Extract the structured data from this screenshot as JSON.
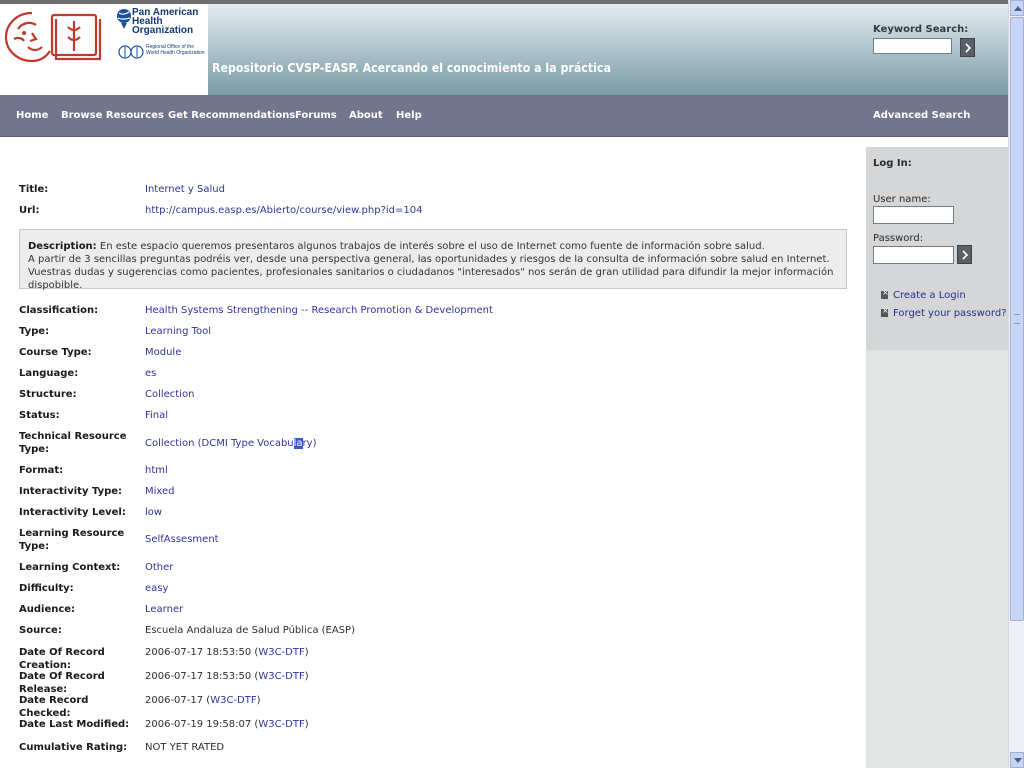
{
  "header": {
    "org_name": "Pan American Health Organization",
    "who_caption": "Regional Office of the World Health Organization",
    "site_title": "Repositorio CVSP-EASP. Acercando el conocimiento a la práctica",
    "keyword_label": "Keyword Search:",
    "keyword_value": ""
  },
  "nav": {
    "items": [
      "Home",
      "Browse Resources",
      "Get Recommendations",
      "Forums",
      "About",
      "Help"
    ],
    "advanced": "Advanced Search"
  },
  "login": {
    "heading": "Log In:",
    "username_label": "User name:",
    "password_label": "Password:",
    "create_login": "Create a Login",
    "forgot": "Forget your password?"
  },
  "record": {
    "title": {
      "label": "Title:",
      "value": "Internet y Salud"
    },
    "url": {
      "label": "Url:",
      "value": "http://campus.easp.es/Abierto/course/view.php?id=104"
    },
    "description": {
      "label": "Description:",
      "line1": "En este espacio queremos presentaros algunos trabajos de interés sobre el uso de Internet como fuente de información sobre salud.",
      "line2": "A partir de 3 sencillas preguntas podréis ver, desde una perspectiva general, las oportunidades y riesgos de la consulta de información sobre salud en Internet.",
      "line3": "Vuestras dudas y sugerencias como pacientes, profesionales sanitarios o ciudadanos \"interesados\" nos serán de gran utilidad para difundir la mejor información dispobible."
    },
    "classification": {
      "label": "Classification:",
      "value": "Health Systems Strengthening -- Research Promotion & Development"
    },
    "type": {
      "label": "Type:",
      "value": "Learning Tool"
    },
    "course_type": {
      "label": "Course Type:",
      "value": "Module"
    },
    "language": {
      "label": "Language:",
      "value": "es"
    },
    "structure": {
      "label": "Structure:",
      "value": "Collection"
    },
    "status": {
      "label": "Status:",
      "value": "Final"
    },
    "technical_resource_type": {
      "label_line1": "Technical Resource",
      "label_line2": "Type:",
      "value": "Collection",
      "qualifier_pre": "(DCMI Type Vocabu",
      "qualifier_hl": "la",
      "qualifier_post": "ry)"
    },
    "format": {
      "label": "Format:",
      "value": "html"
    },
    "interactivity_type": {
      "label": "Interactivity Type:",
      "value": "Mixed"
    },
    "interactivity_level": {
      "label": "Interactivity Level:",
      "value": "low"
    },
    "learning_resource_type": {
      "label_line1": "Learning Resource",
      "label_line2": "Type:",
      "value": "SelfAssesment"
    },
    "learning_context": {
      "label": "Learning Context:",
      "value": "Other"
    },
    "difficulty": {
      "label": "Difficulty:",
      "value": "easy"
    },
    "audience": {
      "label": "Audience:",
      "value": "Learner"
    },
    "source": {
      "label": "Source:",
      "value": "Escuela Andaluza de Salud Pública (EASP)"
    },
    "date_record_creation": {
      "label": "Date Of Record Creation:",
      "value": "2006-07-17 18:53:50",
      "qualifier": "W3C-DTF"
    },
    "date_record_release": {
      "label": "Date Of Record Release:",
      "value": "2006-07-17 18:53:50",
      "qualifier": "W3C-DTF"
    },
    "date_record_checked": {
      "label": "Date Record Checked:",
      "value": "2006-07-17",
      "qualifier": "W3C-DTF"
    },
    "date_last_modified": {
      "label": "Date Last Modified:",
      "value": "2006-07-19 19:58:07",
      "qualifier": "W3C-DTF"
    },
    "cumulative_rating": {
      "label": "Cumulative Rating:",
      "value": "NOT YET RATED"
    }
  },
  "colors": {
    "nav_bg": "#72758d",
    "link": "#2f3598",
    "panel": "#e2e3e3"
  }
}
